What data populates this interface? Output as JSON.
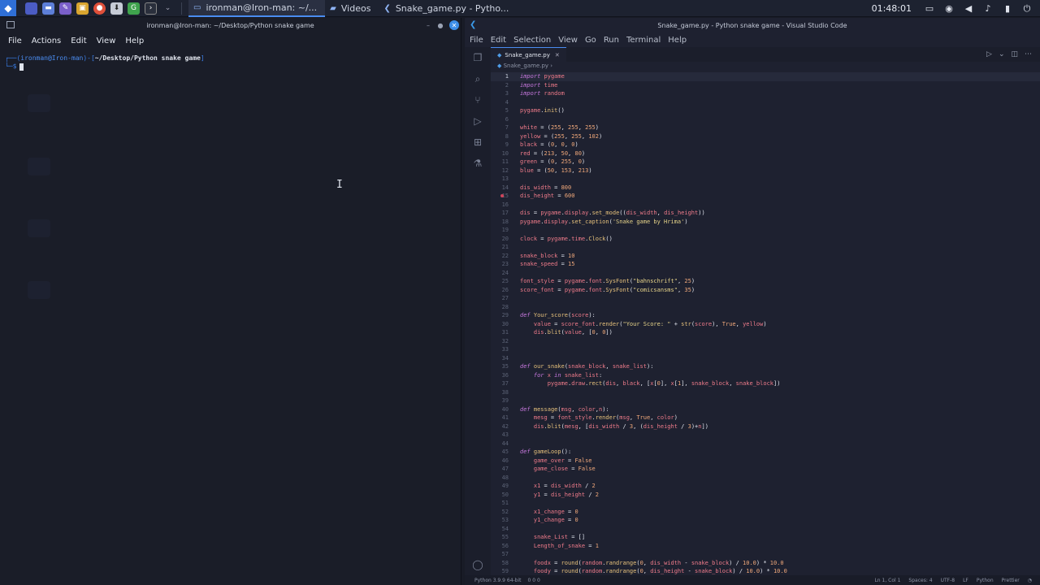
{
  "taskbar": {
    "tasks": [
      {
        "label": "ironman@Iron-man: ~/...",
        "active": true
      },
      {
        "label": "Videos",
        "active": false
      },
      {
        "label": "Snake_game.py - Pytho...",
        "active": false
      }
    ],
    "clock": "01:48:01",
    "accent": "#4a8cf0"
  },
  "terminal": {
    "title": "ironman@Iron-man: ~/Desktop/Python snake game",
    "menu": [
      "File",
      "Actions",
      "Edit",
      "View",
      "Help"
    ],
    "prompt_user": "ironman@Iron-man",
    "prompt_path": "~/Desktop/Python snake game",
    "prompt_symbol": "$"
  },
  "vscode": {
    "title": "Snake_game.py - Python snake game - Visual Studio Code",
    "menu": [
      "File",
      "Edit",
      "Selection",
      "View",
      "Go",
      "Run",
      "Terminal",
      "Help"
    ],
    "tab": "Snake_game.py",
    "breadcrumb": "Snake_game.py",
    "status_left": "Python 3.9.9 64-bit",
    "status_problems": "0 0 0",
    "status_right": [
      "Ln 1, Col 1",
      "Spaces: 4",
      "UTF-8",
      "LF",
      "Python",
      "Prettier"
    ],
    "code_lines": [
      "import pygame",
      "import time",
      "import random",
      "",
      "pygame.init()",
      "",
      "white = (255, 255, 255)",
      "yellow = (255, 255, 102)",
      "black = (0, 0, 0)",
      "red = (213, 50, 80)",
      "green = (0, 255, 0)",
      "blue = (50, 153, 213)",
      "",
      "dis_width = 800",
      "dis_height = 600",
      "",
      "dis = pygame.display.set_mode((dis_width, dis_height))",
      "pygame.display.set_caption('Snake game by Hrima')",
      "",
      "clock = pygame.time.Clock()",
      "",
      "snake_block = 10",
      "snake_speed = 15",
      "",
      "font_style = pygame.font.SysFont(\"bahnschrift\", 25)",
      "score_font = pygame.font.SysFont(\"comicsansms\", 35)",
      "",
      "",
      "def Your_score(score):",
      "    value = score_font.render(\"Your Score: \" + str(score), True, yellow)",
      "    dis.blit(value, [0, 0])",
      "",
      "",
      "",
      "def our_snake(snake_block, snake_list):",
      "    for x in snake_list:",
      "        pygame.draw.rect(dis, black, [x[0], x[1], snake_block, snake_block])",
      "",
      "",
      "def message(msg, color,n):",
      "    mesg = font_style.render(msg, True, color)",
      "    dis.blit(mesg, [dis_width / 3, (dis_height / 3)+n])",
      "",
      "",
      "def gameLoop():",
      "    game_over = False",
      "    game_close = False",
      "",
      "    x1 = dis_width / 2",
      "    y1 = dis_height / 2",
      "",
      "    x1_change = 0",
      "    y1_change = 0",
      "",
      "    snake_List = []",
      "    Length_of_snake = 1",
      "",
      "    foodx = round(random.randrange(0, dis_width - snake_block) / 10.0) * 10.0",
      "    foody = round(random.randrange(0, dis_height - snake_block) / 10.0) * 10.0"
    ]
  }
}
